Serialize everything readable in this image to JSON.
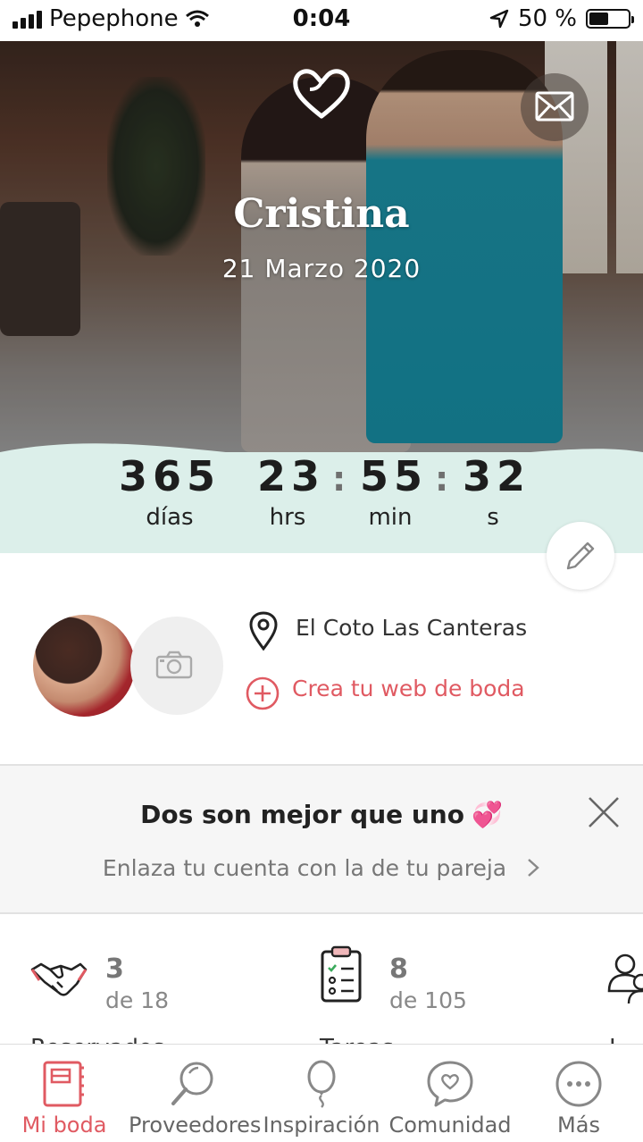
{
  "status_bar": {
    "carrier": "Pepephone",
    "time": "0:04",
    "battery": "50 %",
    "battery_level": 0.5
  },
  "hero": {
    "name": "Cristina",
    "date": "21 Marzo 2020"
  },
  "countdown": {
    "days": "365",
    "days_label": "días",
    "hours": "23",
    "hours_label": "hrs",
    "minutes": "55",
    "minutes_label": "min",
    "seconds": "32",
    "seconds_label": "s"
  },
  "venue": {
    "location": "El Coto Las Canteras",
    "create_web": "Crea tu web de boda"
  },
  "promo": {
    "title": "Dos son mejor que uno",
    "link": "Enlaza tu cuenta con la de tu pareja"
  },
  "stats": [
    {
      "icon": "handshake-icon",
      "value": "3",
      "of": "de 18"
    },
    {
      "icon": "checklist-icon",
      "value": "8",
      "of": "de 105"
    },
    {
      "icon": "guests-icon"
    }
  ],
  "tabs": [
    {
      "label": "Mi boda",
      "icon": "notebook-icon",
      "active": true
    },
    {
      "label": "Proveedores",
      "icon": "magnifier-icon"
    },
    {
      "label": "Inspiración",
      "icon": "balloon-icon"
    },
    {
      "label": "Comunidad",
      "icon": "chat-heart-icon"
    },
    {
      "label": "Más",
      "icon": "more-icon"
    }
  ],
  "colors": {
    "accent": "#e05a62",
    "countdown_bg": "#dcefea",
    "promo_bg": "#f6f6f6"
  }
}
